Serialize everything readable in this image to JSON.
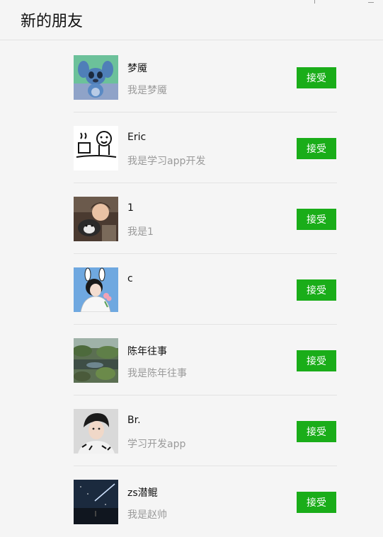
{
  "header": {
    "title": "新的朋友"
  },
  "requests": [
    {
      "name": "梦魇",
      "message": "我是梦魇",
      "accept_label": "接受",
      "avatar_icon": "stitch-avatar-icon"
    },
    {
      "name": "Eric",
      "message": "我是学习app开发",
      "accept_label": "接受",
      "avatar_icon": "doodle-avatar-icon"
    },
    {
      "name": "1",
      "message": "我是1",
      "accept_label": "接受",
      "avatar_icon": "girl-with-dog-avatar-icon"
    },
    {
      "name": "c",
      "message": "",
      "accept_label": "接受",
      "avatar_icon": "bunny-ears-avatar-icon"
    },
    {
      "name": "陈年往事",
      "message": "我是陈年往事",
      "accept_label": "接受",
      "avatar_icon": "garden-photo-avatar-icon"
    },
    {
      "name": "Br.",
      "message": "学习开发app",
      "accept_label": "接受",
      "avatar_icon": "portrait-avatar-icon"
    },
    {
      "name": "zs潜鲲",
      "message": "我是赵帅",
      "accept_label": "接受",
      "avatar_icon": "night-sky-avatar-icon"
    }
  ],
  "colors": {
    "accent": "#1aad19",
    "background": "#f5f5f5",
    "divider": "#e3e3e3"
  }
}
